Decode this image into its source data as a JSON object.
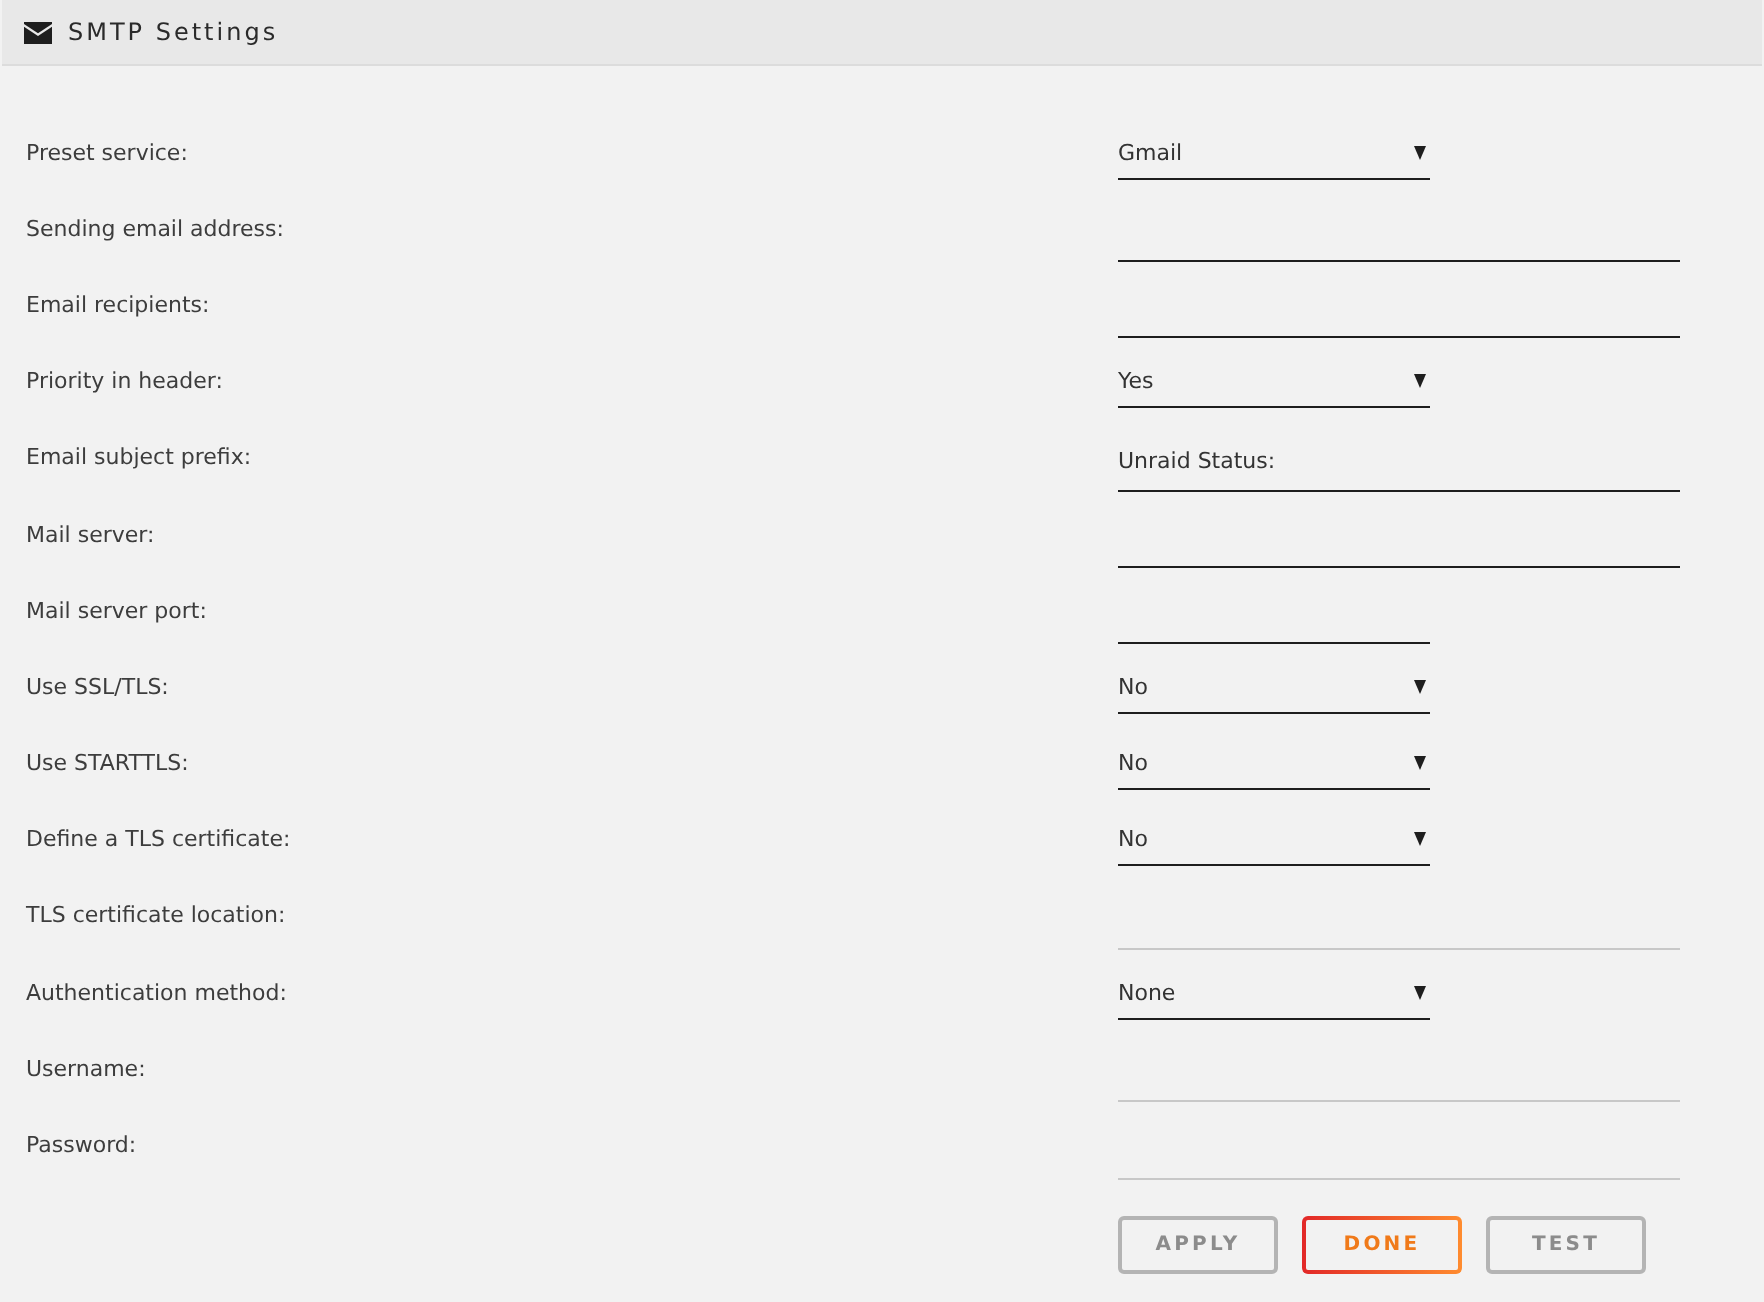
{
  "panel": {
    "title": "SMTP Settings"
  },
  "fields": [
    {
      "label": "Preset service:",
      "kind": "select",
      "value": "Gmail",
      "disabled": false
    },
    {
      "label": "Sending email address:",
      "kind": "text",
      "disabled": false
    },
    {
      "label": "Email recipients:",
      "kind": "text",
      "disabled": false
    },
    {
      "label": "Priority in header:",
      "kind": "select",
      "value": "Yes",
      "disabled": false
    },
    {
      "label": "Email subject prefix:",
      "kind": "text",
      "value": "Unraid Status:",
      "disabled": false
    },
    {
      "label": "Mail server:",
      "kind": "text",
      "disabled": false
    },
    {
      "label": "Mail server port:",
      "kind": "number",
      "disabled": false
    },
    {
      "label": "Use SSL/TLS:",
      "kind": "select",
      "value": "No",
      "disabled": false
    },
    {
      "label": "Use STARTTLS:",
      "kind": "select",
      "value": "No",
      "disabled": false
    },
    {
      "label": "Define a TLS certificate:",
      "kind": "select",
      "value": "No",
      "disabled": false
    },
    {
      "label": "TLS certificate location:",
      "kind": "text",
      "disabled": true
    },
    {
      "label": "Authentication method:",
      "kind": "select",
      "value": "None",
      "disabled": false
    },
    {
      "label": "Username:",
      "kind": "text",
      "disabled": true
    },
    {
      "label": "Password:",
      "kind": "text",
      "disabled": true
    }
  ],
  "buttons": [
    {
      "label": "APPLY",
      "disabled": true
    },
    {
      "label": "DONE",
      "disabled": false
    },
    {
      "label": "TEST",
      "disabled": true
    }
  ]
}
